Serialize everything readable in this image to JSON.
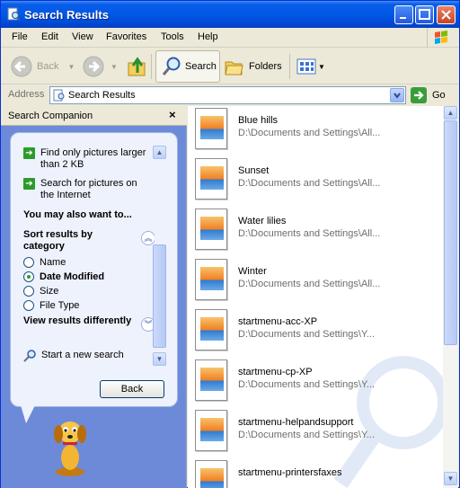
{
  "window": {
    "title": "Search Results"
  },
  "menu": [
    "File",
    "Edit",
    "View",
    "Favorites",
    "Tools",
    "Help"
  ],
  "toolbar": {
    "back_label": "Back",
    "search_label": "Search",
    "folders_label": "Folders"
  },
  "address": {
    "label": "Address",
    "value": "Search Results",
    "go_label": "Go"
  },
  "companion": {
    "title": "Search Companion",
    "close_glyph": "×",
    "links": [
      {
        "text": "Find only pictures larger than 2 KB"
      },
      {
        "text": "Search for pictures on the Internet"
      }
    ],
    "also_heading": "You may also want to...",
    "sort_heading": "Sort results by category",
    "sort_options": [
      {
        "label": "Name",
        "checked": false
      },
      {
        "label": "Date Modified",
        "checked": true
      },
      {
        "label": "Size",
        "checked": false
      },
      {
        "label": "File Type",
        "checked": false
      }
    ],
    "view_heading": "View results differently",
    "new_search": "Start a new search",
    "back_button": "Back"
  },
  "results": [
    {
      "name": "Blue hills",
      "path": "D:\\Documents and Settings\\All..."
    },
    {
      "name": "Sunset",
      "path": "D:\\Documents and Settings\\All..."
    },
    {
      "name": "Water lilies",
      "path": "D:\\Documents and Settings\\All..."
    },
    {
      "name": "Winter",
      "path": "D:\\Documents and Settings\\All..."
    },
    {
      "name": "startmenu-acc-XP",
      "path": "D:\\Documents and Settings\\Y..."
    },
    {
      "name": "startmenu-cp-XP",
      "path": "D:\\Documents and Settings\\Y..."
    },
    {
      "name": "startmenu-helpandsupport",
      "path": "D:\\Documents and Settings\\Y..."
    },
    {
      "name": "startmenu-printersfaxes",
      "path": ""
    }
  ]
}
